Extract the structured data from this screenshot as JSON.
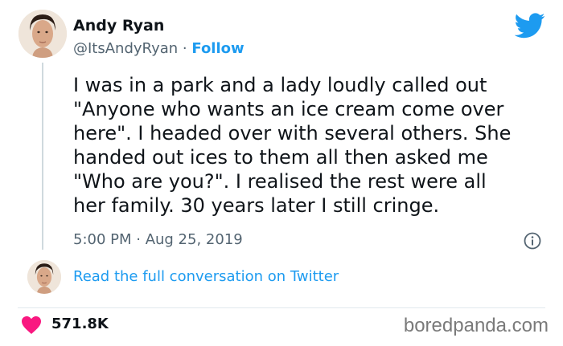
{
  "author": {
    "name": "Andy Ryan",
    "handle": "@ItsAndyRyan",
    "separator": "·",
    "follow_label": "Follow"
  },
  "tweet": {
    "text": "I was in a park and a lady loudly called out\n\"Anyone who wants an ice cream come over\nhere\". I headed over with several others. She\nhanded out ices to them all then asked me\n\"Who are you?\". I realised the rest were all\nher family. 30 years later I still cringe.",
    "timestamp": "5:00 PM · Aug 25, 2019"
  },
  "footer": {
    "read_link": "Read the full conversation on Twitter",
    "likes": "571.8K",
    "watermark": "boredpanda.com"
  },
  "icons": {
    "brand": "twitter-bird-icon",
    "info": "info-icon",
    "like": "heart-icon"
  },
  "colors": {
    "twitter_blue": "#1d9bf0",
    "like_red": "#f91880",
    "text_secondary": "#536471"
  }
}
